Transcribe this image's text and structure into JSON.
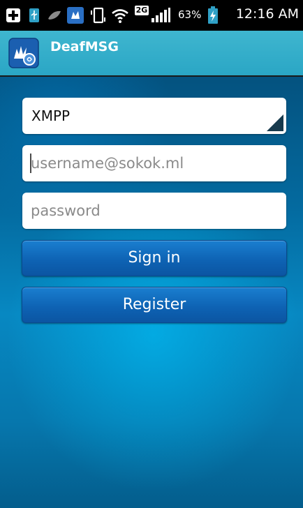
{
  "status_bar": {
    "battery_percent": "63%",
    "clock": "12:16 AM",
    "network_badge": "2G",
    "icons": [
      "add-icon",
      "usb-icon",
      "leaf-icon",
      "app-notification-icon",
      "vibrate-icon",
      "wifi-icon",
      "network-type-icon",
      "signal-icon",
      "battery-charging-icon"
    ]
  },
  "action_bar": {
    "title": "DeafMSG",
    "icon": "deafmsg-app-icon"
  },
  "login": {
    "protocol": "XMPP",
    "username_placeholder": "username@sokok.ml",
    "password_placeholder": "password",
    "signin_label": "Sign in",
    "register_label": "Register"
  },
  "colors": {
    "action_bar": "#2aa6c5",
    "button": "#0e63b4",
    "background_top": "#04527f",
    "background_glow": "#0788c2"
  }
}
